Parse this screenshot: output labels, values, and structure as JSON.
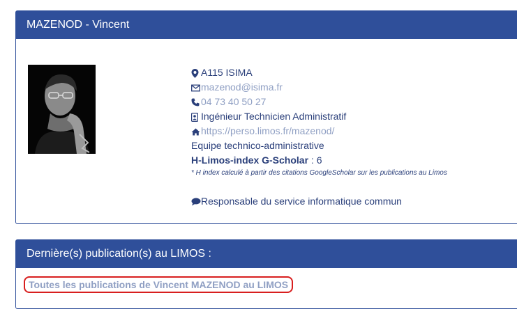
{
  "profile": {
    "name": "MAZENOD - Vincent",
    "office": "A115 ISIMA",
    "email": "mazenod@isima.fr",
    "phone": "04 73 40 50 27",
    "position": "Ingénieur Technicien Administratif",
    "website": "https://perso.limos.fr/mazenod/",
    "team": "Equipe technico-administrative",
    "hindex_label": "H-Limos-index G-Scholar",
    "hindex_value": " : 6",
    "hindex_note": "* H index calculé à partir des citations GoogleScholar sur les publications au Limos",
    "responsibility": "Responsable du service informatique commun"
  },
  "publications": {
    "title": "Dernière(s) publication(s) au LIMOS :",
    "all_link": "Toutes les publications de Vincent MAZENOD au LIMOS"
  },
  "colors": {
    "header_bg": "#2f4f9a",
    "text": "#2a3f7a",
    "muted_link": "#8f9fc3",
    "highlight": "#d81e1e"
  }
}
